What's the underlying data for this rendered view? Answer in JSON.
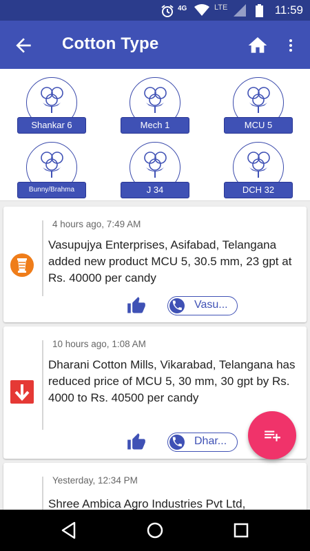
{
  "status_bar": {
    "time": "11:59",
    "network_label": "4G",
    "lte_label": "LTE",
    "icons": [
      "alarm-icon",
      "network-4g-icon",
      "wifi-icon",
      "lte-signal-icon",
      "battery-icon"
    ]
  },
  "app_bar": {
    "title": "Cotton Type",
    "icons": [
      "back-arrow-icon",
      "home-icon",
      "more-vert-icon"
    ]
  },
  "cotton_types": [
    {
      "label": "Shankar 6"
    },
    {
      "label": "Mech 1"
    },
    {
      "label": "MCU 5"
    },
    {
      "label": "Bunny/Brahma"
    },
    {
      "label": "J 34"
    },
    {
      "label": "DCH 32"
    }
  ],
  "feed": [
    {
      "time": "4 hours ago, 7:49 AM",
      "message": "Vasupujya Enterprises, Asifabad, Telangana added new product MCU 5, 30.5 mm, 23 gpt at Rs. 40000 per candy",
      "category_icon": "yarn-spool-icon",
      "call_label": "Vasu..."
    },
    {
      "time": "10 hours ago, 1:08 AM",
      "message": "Dharani Cotton Mills, Vikarabad, Telangana has reduced price of MCU 5, 30 mm, 30 gpt by Rs. 4000 to Rs. 40500 per candy",
      "category_icon": "price-down-icon",
      "call_label": "Dhar..."
    },
    {
      "time": "Yesterday, 12:34 PM",
      "message": "Shree Ambica Agro Industries Pvt Ltd,"
    }
  ],
  "fab": {
    "icon": "playlist-add-icon"
  },
  "nav_bar": {
    "icons": [
      "back-triangle-icon",
      "home-circle-icon",
      "recents-square-icon"
    ]
  },
  "colors": {
    "primary": "#3f51b5",
    "status_bar": "#2b3c8c",
    "accent": "#f0336a",
    "price_down": "#e53935",
    "yarn": "#ef7d1a"
  }
}
